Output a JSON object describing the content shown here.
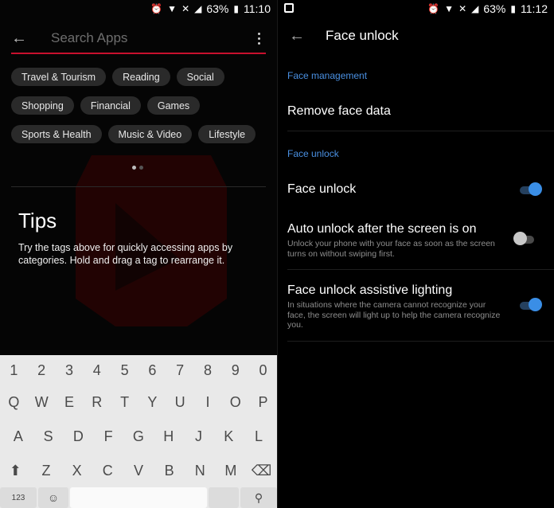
{
  "left": {
    "status": {
      "battery": "63%",
      "time": "11:10"
    },
    "search": {
      "placeholder": "Search Apps"
    },
    "chips": [
      [
        "Travel & Tourism",
        "Reading",
        "Social"
      ],
      [
        "Shopping",
        "Financial",
        "Games"
      ],
      [
        "Sports & Health",
        "Music & Video",
        "Lifestyle"
      ]
    ],
    "tips": {
      "title": "Tips",
      "body": "Try the tags above for quickly accessing apps by categories. Hold and drag a tag to rearrange it."
    },
    "keyboard": {
      "numbers": [
        "1",
        "2",
        "3",
        "4",
        "5",
        "6",
        "7",
        "8",
        "9",
        "0"
      ],
      "row1": [
        "Q",
        "W",
        "E",
        "R",
        "T",
        "Y",
        "U",
        "I",
        "O",
        "P"
      ],
      "row2": [
        "A",
        "S",
        "D",
        "F",
        "G",
        "H",
        "J",
        "K",
        "L"
      ],
      "row3": [
        "Z",
        "X",
        "C",
        "V",
        "B",
        "N",
        "M"
      ],
      "symbols_key": "123"
    }
  },
  "right": {
    "status": {
      "battery": "63%",
      "time": "11:12"
    },
    "title": "Face unlock",
    "section1": "Face management",
    "remove": "Remove face data",
    "section2": "Face unlock",
    "items": [
      {
        "label": "Face unlock",
        "sub": "",
        "on": true
      },
      {
        "label": "Auto unlock after the screen is on",
        "sub": "Unlock your phone with your face as soon as the screen turns on without swiping first.",
        "on": false
      },
      {
        "label": "Face unlock assistive lighting",
        "sub": "In situations where the camera cannot recognize your face, the screen will light up to help the camera recognize you.",
        "on": true
      }
    ]
  },
  "colors": {
    "accent": "#4a90e2",
    "toggle_on": "#3a8ee6",
    "search_line": "#c8102e"
  }
}
